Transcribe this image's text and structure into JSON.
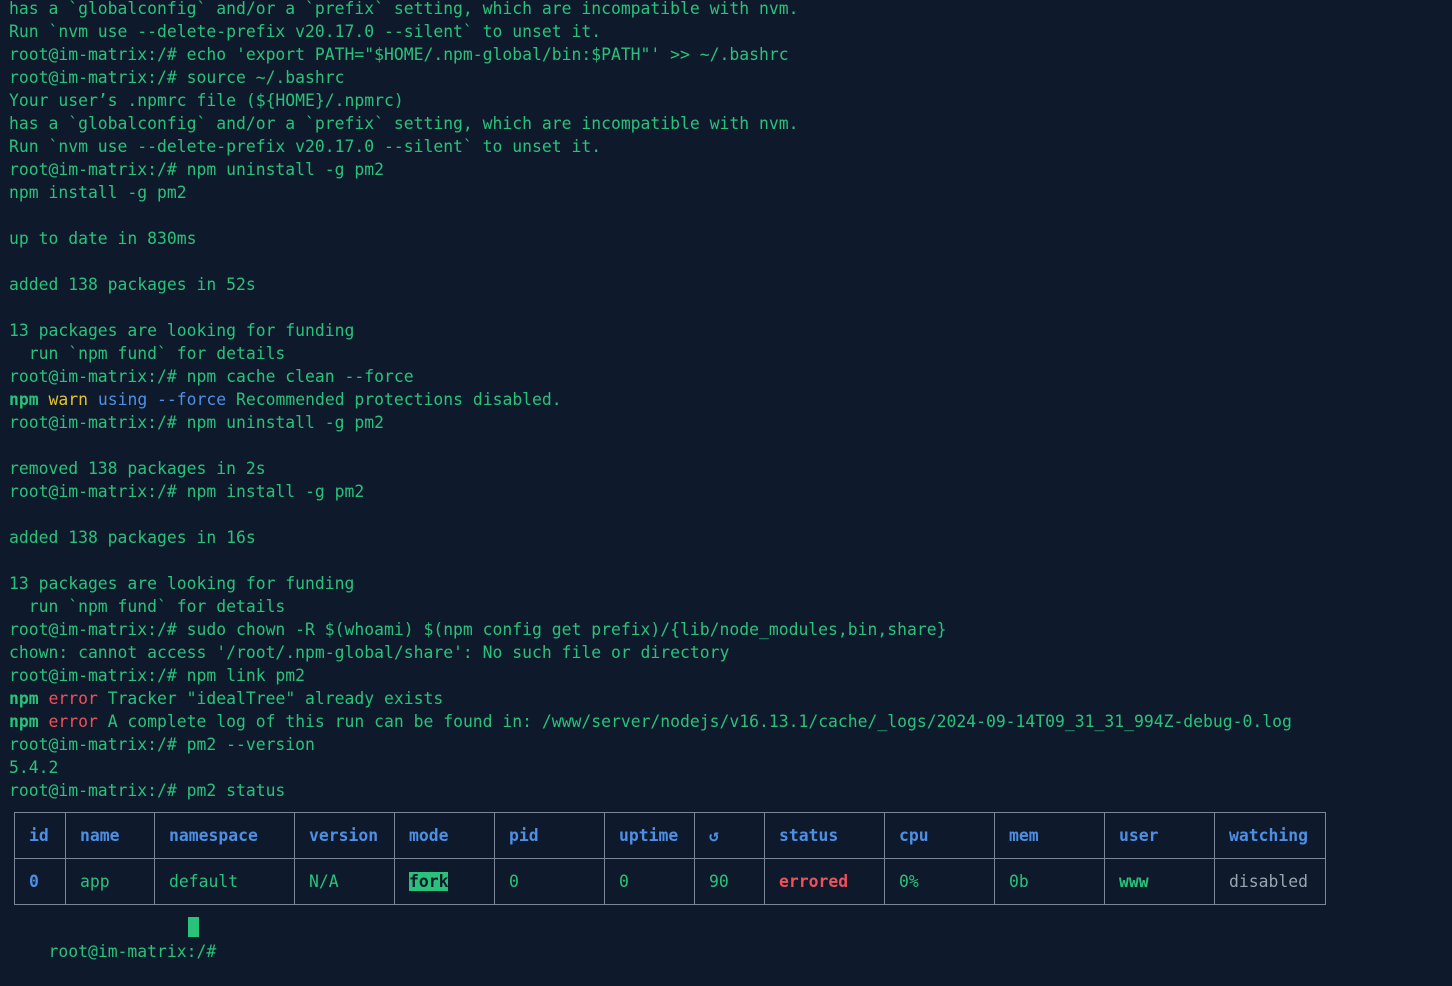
{
  "lines": [
    [
      {
        "t": "has a `globalconfig` and/or a `prefix` setting, which are incompatible with nvm.",
        "s": "plain"
      }
    ],
    [
      {
        "t": "Run `nvm use --delete-prefix v20.17.0 --silent` to unset it.",
        "s": "plain"
      }
    ],
    [
      {
        "t": "root@im-matrix:/# echo 'export PATH=\"$HOME/.npm-global/bin:$PATH\"' >> ~/.bashrc",
        "s": "plain"
      }
    ],
    [
      {
        "t": "root@im-matrix:/# source ~/.bashrc",
        "s": "plain"
      }
    ],
    [
      {
        "t": "Your user’s .npmrc file (${HOME}/.npmrc)",
        "s": "plain"
      }
    ],
    [
      {
        "t": "has a `globalconfig` and/or a `prefix` setting, which are incompatible with nvm.",
        "s": "plain"
      }
    ],
    [
      {
        "t": "Run `nvm use --delete-prefix v20.17.0 --silent` to unset it.",
        "s": "plain"
      }
    ],
    [
      {
        "t": "root@im-matrix:/# npm uninstall -g pm2",
        "s": "plain"
      }
    ],
    [
      {
        "t": "npm install -g pm2",
        "s": "plain"
      }
    ],
    [],
    [
      {
        "t": "up to date in 830ms",
        "s": "plain"
      }
    ],
    [],
    [
      {
        "t": "added 138 packages in 52s",
        "s": "plain"
      }
    ],
    [],
    [
      {
        "t": "13 packages are looking for funding",
        "s": "plain"
      }
    ],
    [
      {
        "t": "  run `npm fund` for details",
        "s": "plain"
      }
    ],
    [
      {
        "t": "root@im-matrix:/# npm cache clean --force",
        "s": "plain"
      }
    ],
    [
      {
        "t": "npm",
        "s": "bold"
      },
      {
        "t": " ",
        "s": "plain"
      },
      {
        "t": "warn",
        "s": "warn"
      },
      {
        "t": " ",
        "s": "plain"
      },
      {
        "t": "using --force",
        "s": "blue"
      },
      {
        "t": " Recommended protections disabled.",
        "s": "plain"
      }
    ],
    [
      {
        "t": "root@im-matrix:/# npm uninstall -g pm2",
        "s": "plain"
      }
    ],
    [],
    [
      {
        "t": "removed 138 packages in 2s",
        "s": "plain"
      }
    ],
    [
      {
        "t": "root@im-matrix:/# npm install -g pm2",
        "s": "plain"
      }
    ],
    [],
    [
      {
        "t": "added 138 packages in 16s",
        "s": "plain"
      }
    ],
    [],
    [
      {
        "t": "13 packages are looking for funding",
        "s": "plain"
      }
    ],
    [
      {
        "t": "  run `npm fund` for details",
        "s": "plain"
      }
    ],
    [
      {
        "t": "root@im-matrix:/# sudo chown -R $(whoami) $(npm config get prefix)/{lib/node_modules,bin,share}",
        "s": "plain"
      }
    ],
    [
      {
        "t": "chown: cannot access '/root/.npm-global/share': No such file or directory",
        "s": "plain"
      }
    ],
    [
      {
        "t": "root@im-matrix:/# npm link pm2",
        "s": "plain"
      }
    ],
    [
      {
        "t": "npm",
        "s": "bold"
      },
      {
        "t": " ",
        "s": "plain"
      },
      {
        "t": "error",
        "s": "error"
      },
      {
        "t": " Tracker \"idealTree\" already exists",
        "s": "plain"
      }
    ],
    [
      {
        "t": "npm",
        "s": "bold"
      },
      {
        "t": " ",
        "s": "plain"
      },
      {
        "t": "error",
        "s": "error"
      },
      {
        "t": " A complete log of this run can be found in: /www/server/nodejs/v16.13.1/cache/_logs/2024-09-14T09_31_31_994Z-debug-0.log",
        "s": "plain"
      }
    ],
    [
      {
        "t": "root@im-matrix:/# pm2 --version",
        "s": "plain"
      }
    ],
    [
      {
        "t": "5.4.2",
        "s": "plain"
      }
    ],
    [
      {
        "t": "root@im-matrix:/# pm2 status",
        "s": "plain"
      }
    ]
  ],
  "table": {
    "headers": {
      "id": "id",
      "name": "name",
      "namespace": "namespace",
      "version": "version",
      "mode": "mode",
      "pid": "pid",
      "uptime": "uptime",
      "restarts": "↺",
      "status": "status",
      "cpu": "cpu",
      "mem": "mem",
      "user": "user",
      "watching": "watching"
    },
    "row": {
      "id": "0",
      "name": "app",
      "namespace": "default",
      "version": "N/A",
      "mode": "fork",
      "pid": "0",
      "uptime": "0",
      "restarts": "90",
      "status": "errored",
      "cpu": "0%",
      "mem": "0b",
      "user": "www",
      "watching": "disabled"
    }
  },
  "prompt": "root@im-matrix:/# "
}
